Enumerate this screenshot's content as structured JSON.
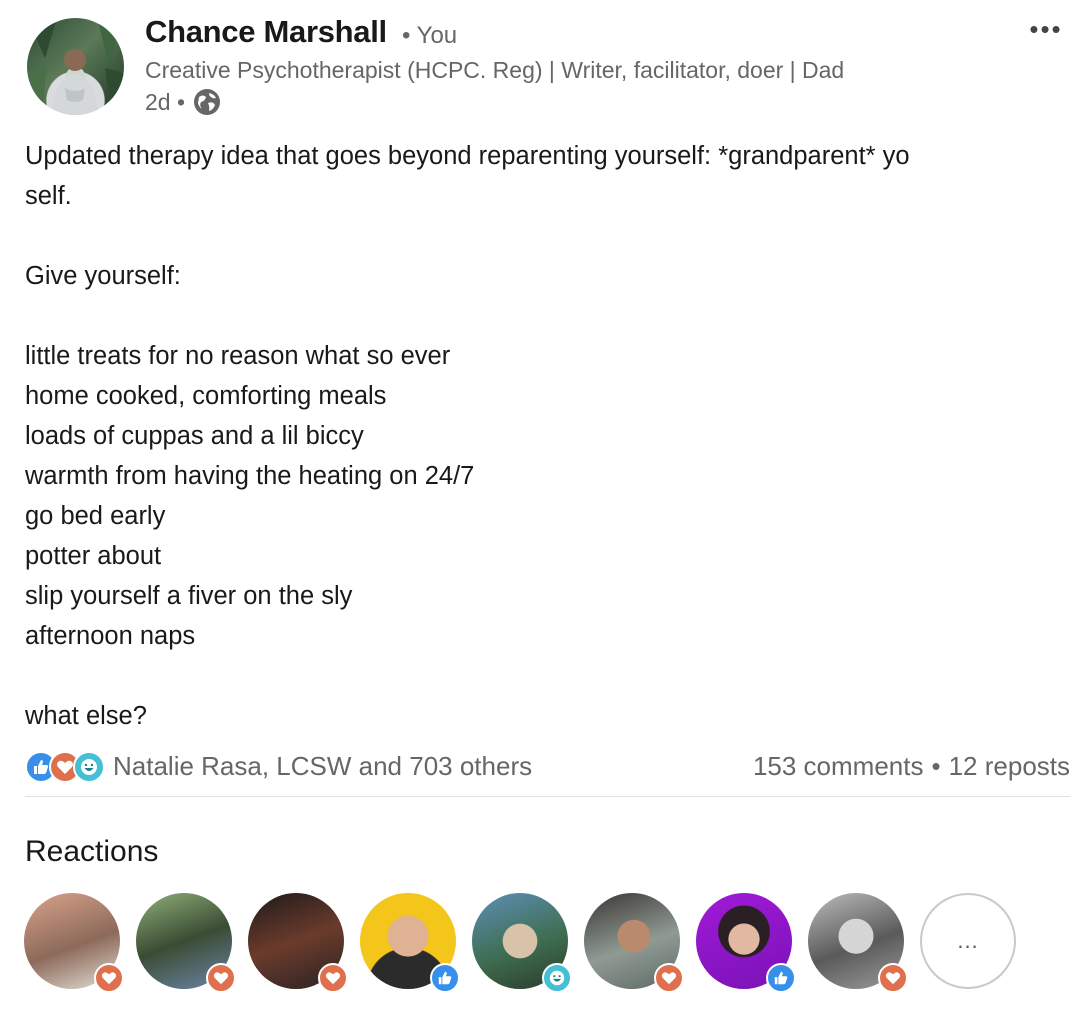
{
  "author": {
    "name": "Chance Marshall",
    "degree": "• You",
    "headline": "Creative Psychotherapist (HCPC. Reg) | Writer, facilitator, doer | Dad",
    "time": "2d •",
    "visibility_icon": "globe-icon"
  },
  "post": {
    "lines": [
      "Updated therapy idea that goes beyond reparenting yourself: *grandparent* yo",
      "self.",
      "",
      "Give yourself:",
      "",
      "little treats for no reason what so ever",
      "home cooked, comforting meals",
      "loads of cuppas and a lil biccy",
      "warmth from having the heating on 24/7",
      "go bed early",
      "potter about",
      "slip yourself a fiver on the sly",
      "afternoon naps",
      "",
      "what else?"
    ]
  },
  "social": {
    "reactions_text": "Natalie Rasa, LCSW and 703 others",
    "comments": "153 comments",
    "separator": "•",
    "reposts": "12 reposts"
  },
  "reactions_section": {
    "title": "Reactions",
    "more_label": "..."
  },
  "colors": {
    "like": "#378fe9",
    "love": "#df704d",
    "support": "#44bfd3",
    "text_secondary": "#666666"
  },
  "reactors": [
    {
      "reaction": "love",
      "icon": "heart-icon"
    },
    {
      "reaction": "love",
      "icon": "heart-icon"
    },
    {
      "reaction": "love",
      "icon": "heart-icon"
    },
    {
      "reaction": "like",
      "icon": "thumbs-up-icon"
    },
    {
      "reaction": "support",
      "icon": "smile-icon"
    },
    {
      "reaction": "love",
      "icon": "heart-icon"
    },
    {
      "reaction": "like",
      "icon": "thumbs-up-icon"
    },
    {
      "reaction": "love",
      "icon": "heart-icon"
    }
  ]
}
